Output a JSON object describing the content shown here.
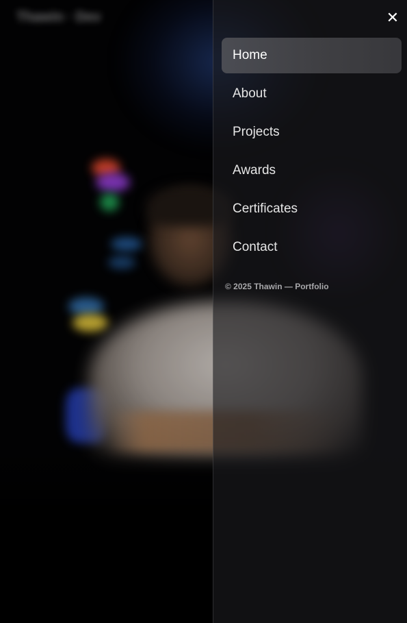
{
  "background": {
    "logo_text": "Thawin · Dev"
  },
  "drawer": {
    "close_glyph": "✕",
    "nav_items": [
      {
        "label": "Home",
        "active": true
      },
      {
        "label": "About",
        "active": false
      },
      {
        "label": "Projects",
        "active": false
      },
      {
        "label": "Awards",
        "active": false
      },
      {
        "label": "Certificates",
        "active": false
      },
      {
        "label": "Contact",
        "active": false
      }
    ],
    "footer_text": "© 2025 Thawin — Portfolio"
  },
  "icons": {
    "close": "close-icon",
    "background_icons": [
      "figma-icon",
      "typescript-icon",
      "python-icon",
      "app-icon"
    ]
  },
  "colors": {
    "accent_glow": "#284690",
    "drawer_bg": "#1c1c1e",
    "active_item_bg": "#5c5c60",
    "nav_text": "#e6e6e6",
    "footer_text": "#a8a8ab"
  }
}
